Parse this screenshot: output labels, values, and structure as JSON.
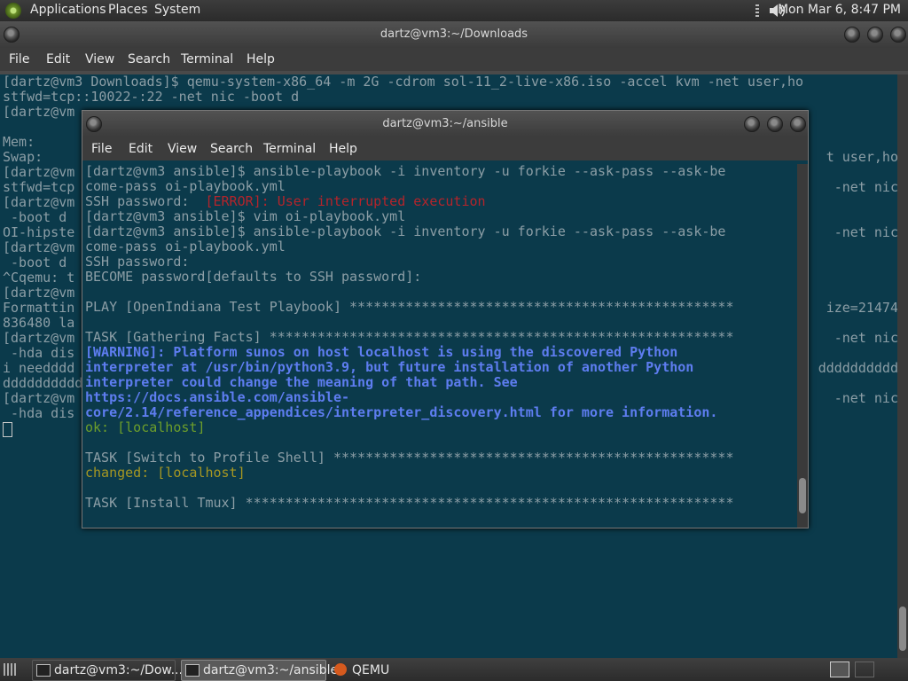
{
  "top_panel": {
    "menus": [
      "Applications",
      "Places",
      "System"
    ],
    "clock": "Mon Mar 6,  8:47 PM"
  },
  "win_downloads": {
    "title": "dartz@vm3:~/Downloads",
    "menu": [
      "File",
      "Edit",
      "View",
      "Search",
      "Terminal",
      "Help"
    ],
    "lines": [
      "[dartz@vm3 Downloads]$ qemu-system-x86_64 -m 2G -cdrom sol-11_2-live-x86.iso -accel kvm -net user,ho",
      "stfwd=tcp::10022-:22 -net nic -boot d",
      "[dartz@vm",
      "",
      "Mem:",
      "Swap:",
      "[dartz@vm",
      "stfwd=tcp",
      "[dartz@vm",
      " -boot d",
      "OI-hipste",
      "[dartz@vm",
      " -boot d",
      "^Cqemu: t",
      "[dartz@vm",
      "Formattin",
      "836480 la",
      "[dartz@vm",
      " -hda dis",
      "i needddd",
      "dddddddddd",
      "[dartz@vm",
      " -hda dis"
    ],
    "right_fragments": [
      {
        "row": 5,
        "text": "t user,ho"
      },
      {
        "row": 7,
        "text": "-net nic"
      },
      {
        "row": 10,
        "text": "-net nic"
      },
      {
        "row": 15,
        "text": "ize=21474"
      },
      {
        "row": 17,
        "text": "-net nic"
      },
      {
        "row": 19,
        "text": "dddddddddd"
      },
      {
        "row": 21,
        "text": "-net nic"
      }
    ]
  },
  "win_ansible": {
    "title": "dartz@vm3:~/ansible",
    "menu": [
      "File",
      "Edit",
      "View",
      "Search",
      "Terminal",
      "Help"
    ],
    "lines": [
      "[dartz@vm3 ansible]$ ansible-playbook -i inventory -u forkie --ask-pass --ask-be",
      "come-pass oi-playbook.yml",
      "SSH password:  ",
      "[dartz@vm3 ansible]$ vim oi-playbook.yml",
      "[dartz@vm3 ansible]$ ansible-playbook -i inventory -u forkie --ask-pass --ask-be",
      "come-pass oi-playbook.yml",
      "SSH password:",
      "BECOME password[defaults to SSH password]:",
      "",
      "PLAY [OpenIndiana Test Playbook] ************************************************",
      "",
      "TASK [Gathering Facts] **********************************************************",
      "",
      "",
      "",
      "",
      "",
      "",
      "",
      "TASK [Switch to Profile Shell] **************************************************",
      "",
      "",
      "TASK [Install Tmux] *************************************************************"
    ],
    "error_text": "[ERROR]: User interrupted execution",
    "warning_lines": [
      "[WARNING]: Platform sunos on host localhost is using the discovered Python",
      "interpreter at /usr/bin/python3.9, but future installation of another Python",
      "interpreter could change the meaning of that path. See",
      "https://docs.ansible.com/ansible-",
      "core/2.14/reference_appendices/interpreter_discovery.html for more information."
    ],
    "ok_text": "ok: [localhost]",
    "changed_text": "changed: [localhost]"
  },
  "taskbar": {
    "items": [
      {
        "label": "dartz@vm3:~/Dow...",
        "icon": "terminal-icon"
      },
      {
        "label": "dartz@vm3:~/ansible",
        "icon": "terminal-icon"
      },
      {
        "label": "QEMU",
        "icon": "qemu-icon"
      }
    ]
  }
}
